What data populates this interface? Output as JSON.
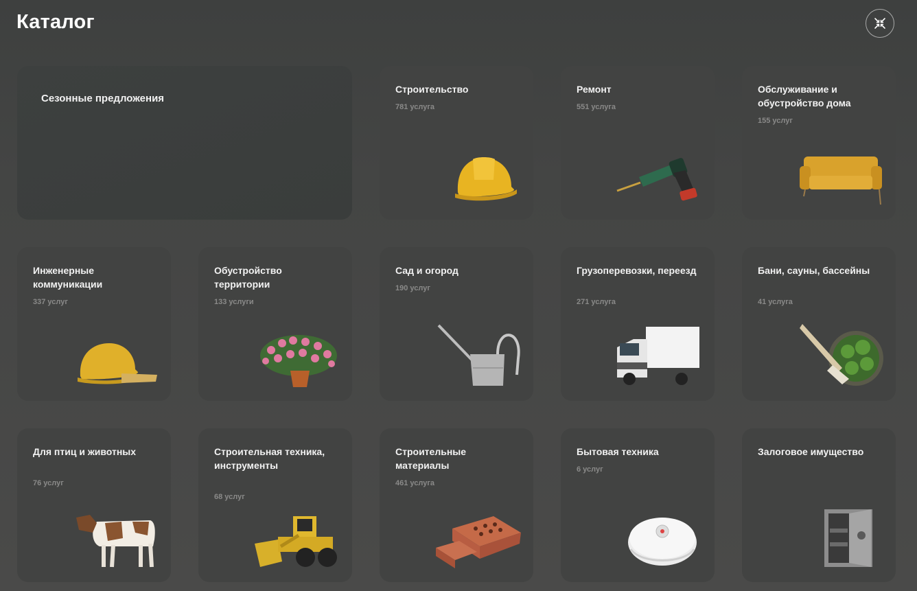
{
  "header": {
    "title": "Каталог"
  },
  "catalog": [
    {
      "title": "Сезонные предложения",
      "count": ""
    },
    {
      "title": "Строительство",
      "count": "781 услуга"
    },
    {
      "title": "Ремонт",
      "count": "551 услуга"
    },
    {
      "title": "Обслуживание и обустройство дома",
      "count": "155 услуг"
    },
    {
      "title": "Инженерные коммуникации",
      "count": "337 услуг"
    },
    {
      "title": "Обустройство территории",
      "count": "133 услуги"
    },
    {
      "title": "Сад и огород",
      "count": "190 услуг"
    },
    {
      "title": "Грузоперевозки, переезд",
      "count": "271 услуга"
    },
    {
      "title": "Бани, сауны, бассейны",
      "count": "41 услуга"
    },
    {
      "title": "Для птиц и животных",
      "count": "76 услуг"
    },
    {
      "title": "Строительная техника, инструменты",
      "count": "68 услуг"
    },
    {
      "title": "Строительные материалы",
      "count": "461 услуга"
    },
    {
      "title": "Бытовая техника",
      "count": "6 услуг"
    },
    {
      "title": "Залоговое имущество",
      "count": ""
    }
  ],
  "icons": [
    "close-icon",
    "hard-hat-icon",
    "drill-icon",
    "sofa-icon",
    "hat-gloves-icon",
    "flowers-icon",
    "watering-can-icon",
    "truck-icon",
    "bath-broom-icon",
    "cow-icon",
    "loader-icon",
    "brick-icon",
    "robot-vacuum-icon",
    "safe-icon"
  ],
  "colors": {
    "background": "#474847",
    "card": "#424342",
    "count_text": "#8a8a89",
    "accent_yellow": "#e8b422"
  }
}
